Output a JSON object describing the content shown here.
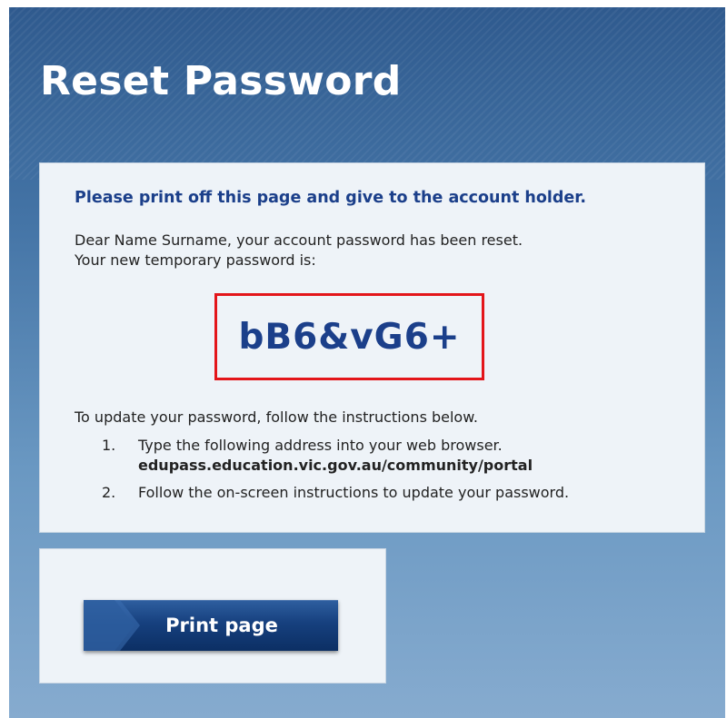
{
  "page": {
    "title": "Reset Password"
  },
  "notice": {
    "instruction": "Please print off this page and give to the account holder.",
    "intro_line1": "Dear Name Surname, your account password has been reset.",
    "intro_line2": "Your new temporary password is:",
    "temporary_password": "bB6&vG6+",
    "highlight_color": "#e3151a"
  },
  "instructions": {
    "intro": "To update your password, follow the instructions below.",
    "steps": [
      {
        "number": "1.",
        "text": "Type the following address into your web browser.",
        "url": "edupass.education.vic.gov.au/community/portal"
      },
      {
        "number": "2.",
        "text": "Follow the on-screen instructions to update your password."
      }
    ]
  },
  "actions": {
    "print_label": "Print page",
    "print_icon": "arrow-chevron-icon"
  },
  "colors": {
    "accent_text": "#1b3f8a",
    "button": "#16407e",
    "panel_top": "#2f5a8e",
    "panel_bottom": "#86abcf"
  }
}
